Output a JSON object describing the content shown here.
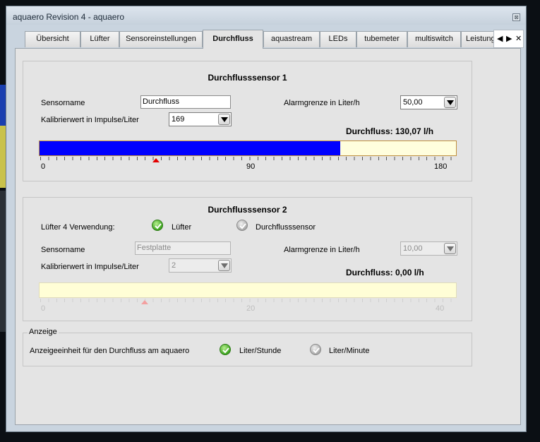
{
  "window": {
    "title": "aquaero Revision 4 -  aquaero",
    "close_glyph": "⊠"
  },
  "tabs": [
    {
      "label": "Übersicht",
      "active": false
    },
    {
      "label": "Lüfter",
      "active": false
    },
    {
      "label": "Sensoreinstellungen",
      "active": false
    },
    {
      "label": "Durchfluss",
      "active": true
    },
    {
      "label": "aquastream",
      "active": false
    },
    {
      "label": "LEDs",
      "active": false
    },
    {
      "label": "tubemeter",
      "active": false
    },
    {
      "label": "multiswitch",
      "active": false
    },
    {
      "label": "Leistung",
      "active": false
    }
  ],
  "tab_nav": {
    "prev": "◀",
    "next": "▶",
    "close": "✕"
  },
  "sensor1": {
    "title": "Durchflusssensor 1",
    "name_label": "Sensorname",
    "name_value": "Durchfluss",
    "calib_label": "Kalibrierwert in Impulse/Liter",
    "calib_value": "169",
    "alarm_label": "Alarmgrenze in Liter/h",
    "alarm_value": "50,00",
    "flow_text": "Durchfluss: 130,07 l/h",
    "flow_value": 130.07,
    "scale_max": 180,
    "alarm_marker": 50,
    "ticks": [
      "0",
      "90",
      "180"
    ]
  },
  "sensor2": {
    "title": "Durchflusssensor 2",
    "usage_label": "Lüfter 4 Verwendung:",
    "option_fan": "Lüfter",
    "option_flow": "Durchflusssensor",
    "name_label": "Sensorname",
    "name_value": "Festplatte",
    "calib_label": "Kalibrierwert in Impulse/Liter",
    "calib_value": "2",
    "alarm_label": "Alarmgrenze in Liter/h",
    "alarm_value": "10,00",
    "flow_text": "Durchfluss: 0,00 l/h",
    "flow_value": 0,
    "scale_max": 40,
    "alarm_marker": 10,
    "ticks": [
      "0",
      "20",
      "40"
    ]
  },
  "anzeige": {
    "legend": "Anzeige",
    "label": "Anzeigeeinheit für den Durchfluss am aquaero",
    "option_hour": "Liter/Stunde",
    "option_minute": "Liter/Minute"
  },
  "colors": {
    "bar_fill": "#0000ff",
    "alarm_marker": "#e30000",
    "radio_checked": "#3da41f"
  }
}
